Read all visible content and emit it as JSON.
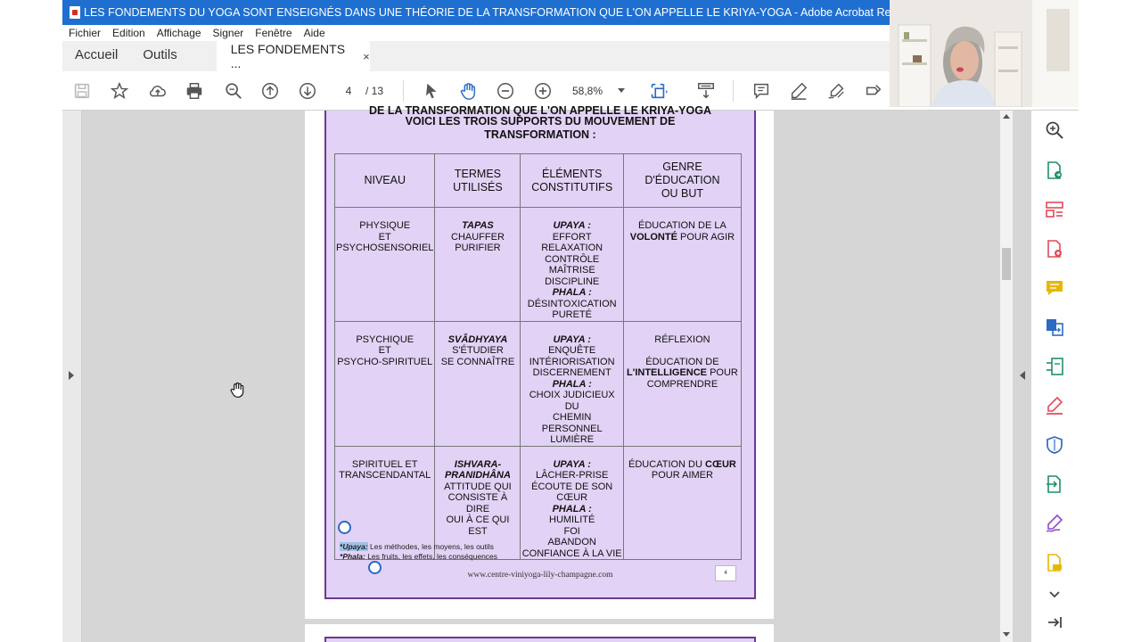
{
  "window": {
    "title": "LES FONDEMENTS DU YOGA SONT ENSEIGNÉS DANS UNE THÉORIE DE LA TRANSFORMATION QUE L'ON APPELLE LE KRIYA-YOGA - Adobe Acrobat Reader DC"
  },
  "menu": [
    "Fichier",
    "Edition",
    "Affichage",
    "Signer",
    "Fenêtre",
    "Aide"
  ],
  "tabs": {
    "home": "Accueil",
    "tools": "Outils",
    "document": "LES FONDEMENTS ...",
    "close": "×"
  },
  "toolbar": {
    "page_current": "4",
    "page_total": "/ 13",
    "zoom": "58,8%"
  },
  "document": {
    "heading_clipped": "DE LA TRANSFORMATION QUE L'ON APPELLE LE KRIYA-YOGA",
    "heading_1": "VOICI LES TROIS SUPPORTS DU MOUVEMENT DE",
    "heading_2": "TRANSFORMATION :",
    "table": {
      "headers": {
        "h1": "NIVEAU",
        "h2a": "TERMES",
        "h2b": "UTILISÉS",
        "h3a": "ÉLÉMENTS",
        "h3b": "CONSTITUTIFS",
        "h4a": "GENRE D'ÉDUCATION",
        "h4b": "OU BUT"
      },
      "row1": {
        "niveau": [
          "PHYSIQUE",
          "ET",
          "PSYCHOSENSORIEL"
        ],
        "terme": "TAPAS",
        "terme_lines": [
          "CHAUFFER",
          "PURIFIER"
        ],
        "upaya_label": "UPAYA :",
        "upaya": [
          "EFFORT",
          "RELAXATION",
          "CONTRÔLE",
          "MAÎTRISE",
          "DISCIPLINE"
        ],
        "phala_label": "PHALA :",
        "phala": [
          "DÉSINTOXICATION",
          "PURETÉ"
        ],
        "but_pre": "ÉDUCATION DE LA",
        "but_bold": "VOLONTÉ",
        "but_post": " POUR AGIR"
      },
      "row2": {
        "niveau": [
          "PSYCHIQUE",
          "ET",
          "PSYCHO-SPIRITUEL"
        ],
        "terme": "SVÂDHYAYA",
        "terme_lines": [
          "S'ÉTUDIER",
          "SE CONNAÎTRE"
        ],
        "upaya_label": "UPAYA :",
        "upaya": [
          "ENQUÊTE",
          "INTÉRIORISATION",
          "DISCERNEMENT"
        ],
        "phala_label": "PHALA :",
        "phala": [
          "CHOIX JUDICIEUX DU",
          "CHEMIN PERSONNEL",
          "LUMIÈRE"
        ],
        "but_line1": "RÉFLEXION",
        "but_pre": "ÉDUCATION DE",
        "but_bold": "L'INTELLIGENCE",
        "but_post": " POUR",
        "but_line_last": "COMPRENDRE"
      },
      "row3": {
        "niveau": [
          "SPIRITUEL ET",
          "TRANSCENDANTAL"
        ],
        "terme_a": "ISHVARA-",
        "terme_b": "PRANIDHÂNA",
        "terme_lines": [
          "ATTITUDE QUI",
          "CONSISTE À DIRE",
          "OUI À CE QUI EST"
        ],
        "upaya_label": "UPAYA :",
        "upaya": [
          "LÂCHER-PRISE",
          "ÉCOUTE DE SON",
          "CŒUR"
        ],
        "phala_label": "PHALA :",
        "phala": [
          "HUMILITÉ",
          "FOI",
          "ABANDON",
          "CONFIANCE À LA VIE"
        ],
        "but_pre": "ÉDUCATION DU ",
        "but_bold": "CŒUR",
        "but_line_last": "POUR AIMER"
      }
    },
    "notes": {
      "n1_star": "*",
      "n1_term": "Upaya:",
      "n1_text": " Les méthodes, les moyens, les outils",
      "n2_star": "*",
      "n2_term": "Phala:",
      "n2_text": " Les fruits, les effets, les conséquences"
    },
    "footer_url": "www.centre-viniyoga-lily-champagne.com",
    "page_number": "4"
  },
  "colors": {
    "titlebar": "#1e6fd0",
    "page_fill": "#e2d2f5",
    "page_border": "#6a3a8e",
    "right_panel_icons": [
      "#e34a5a",
      "#1f8f6a",
      "#e8b700",
      "#2d6ac4",
      "#8f4ac9"
    ]
  },
  "icons": {
    "right_panel": [
      "search-zoom-icon",
      "export-pdf-icon",
      "organize-pages-icon",
      "create-pdf-icon",
      "comment-icon",
      "combine-files-icon",
      "edit-pdf-icon",
      "fill-sign-icon",
      "protect-icon",
      "send-review-icon",
      "sign-icon",
      "more-tools-icon",
      "expand-down-icon",
      "collapse-panel-icon"
    ]
  }
}
